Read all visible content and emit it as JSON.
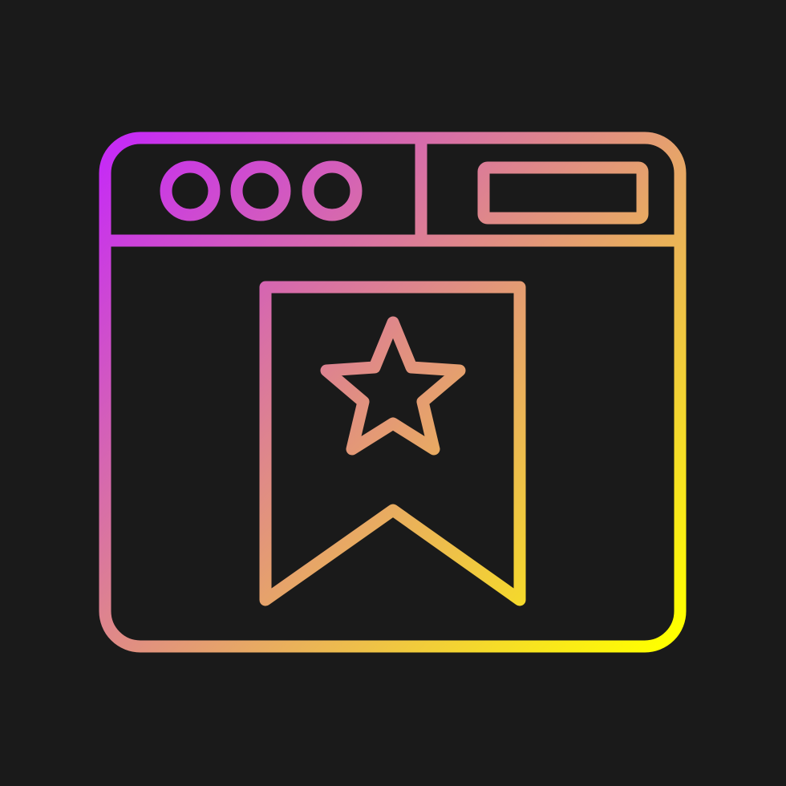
{
  "icon": {
    "name": "browser-bookmark-icon",
    "background_color": "#1a1a1a",
    "gradient_start_color": "#c62cf4",
    "gradient_end_color": "#ffff00",
    "elements": {
      "window": "browser-window-icon",
      "dots": "window-control-dots-icon",
      "address_bar": "address-bar-icon",
      "bookmark": "bookmark-ribbon-icon",
      "star": "star-icon"
    }
  }
}
